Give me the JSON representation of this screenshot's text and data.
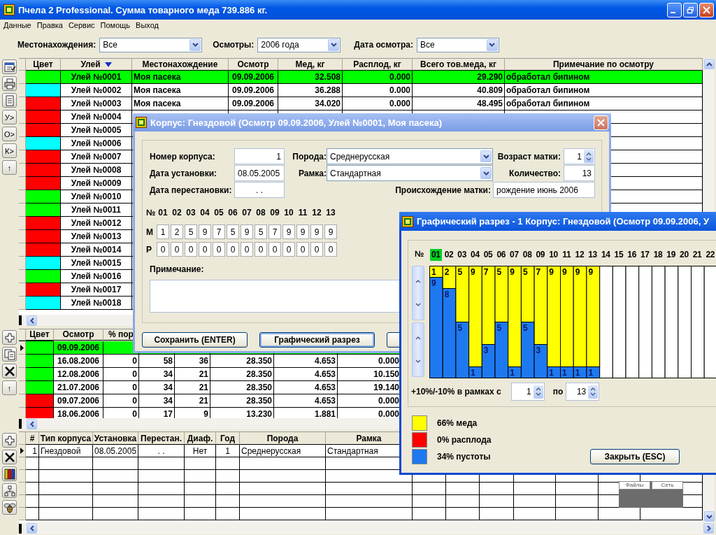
{
  "window": {
    "title": "Пчела 2 Professional. Сумма товарного меда 739.886 кг."
  },
  "menu": [
    "Данные",
    "Правка",
    "Сервис",
    "Помощь",
    "Выход"
  ],
  "filters": [
    {
      "label": "Местонахождения:",
      "value": "Все"
    },
    {
      "label": "Осмотры:",
      "value": "2006 года"
    },
    {
      "label": "Дата осмотра:",
      "value": "Все"
    }
  ],
  "hives_toolbar": [
    {
      "kind": "properties"
    },
    {
      "kind": "print"
    },
    {
      "kind": "document"
    },
    {
      "kind": "text",
      "label": "У>"
    },
    {
      "kind": "text",
      "label": "О>"
    },
    {
      "kind": "text",
      "label": "К>"
    },
    {
      "kind": "text",
      "label": "↑"
    }
  ],
  "hives_table": {
    "columns": [
      {
        "label": "Цвет",
        "sorted": false
      },
      {
        "label": "Улей",
        "sorted": true
      },
      {
        "label": "Местонахождение",
        "sorted": false
      },
      {
        "label": "Осмотр",
        "sorted": false
      },
      {
        "label": "Мед, кг",
        "sorted": false
      },
      {
        "label": "Расплод, кг",
        "sorted": false
      },
      {
        "label": "Всего тов.меда, кг",
        "sorted": false
      },
      {
        "label": "Примечание по осмотру",
        "sorted": false
      }
    ],
    "rows": [
      {
        "selected": true,
        "color": "#00ff00",
        "cells": [
          "",
          "Улей №0001",
          "Моя пасека",
          "09.09.2006",
          "32.508",
          "0.000",
          "29.290",
          "обработал бипином"
        ]
      },
      {
        "selected": false,
        "color": "#00ffff",
        "cells": [
          "",
          "Улей №0002",
          "Моя пасека",
          "09.09.2006",
          "36.288",
          "0.000",
          "40.809",
          "обработал бипином"
        ]
      },
      {
        "selected": false,
        "color": "#ff0000",
        "cells": [
          "",
          "Улей №0003",
          "Моя пасека",
          "09.09.2006",
          "34.020",
          "0.000",
          "48.495",
          "обработал бипином"
        ]
      },
      {
        "selected": false,
        "color": "#ff0000",
        "cells": [
          "",
          "Улей №0004"
        ]
      },
      {
        "selected": false,
        "color": "#ff0000",
        "cells": [
          "",
          "Улей №0005"
        ]
      },
      {
        "selected": false,
        "color": "#00ffff",
        "cells": [
          "",
          "Улей №0006"
        ]
      },
      {
        "selected": false,
        "color": "#ff0000",
        "cells": [
          "",
          "Улей №0007"
        ]
      },
      {
        "selected": false,
        "color": "#ff0000",
        "cells": [
          "",
          "Улей №0008"
        ]
      },
      {
        "selected": false,
        "color": "#ff0000",
        "cells": [
          "",
          "Улей №0009"
        ]
      },
      {
        "selected": false,
        "color": "#00ff00",
        "cells": [
          "",
          "Улей №0010"
        ]
      },
      {
        "selected": false,
        "color": "#00ff00",
        "cells": [
          "",
          "Улей №0011"
        ]
      },
      {
        "selected": false,
        "color": "#ff0000",
        "cells": [
          "",
          "Улей №0012"
        ]
      },
      {
        "selected": false,
        "color": "#ff0000",
        "cells": [
          "",
          "Улей №0013"
        ]
      },
      {
        "selected": false,
        "color": "#ff0000",
        "cells": [
          "",
          "Улей №0014"
        ]
      },
      {
        "selected": false,
        "color": "#00ffff",
        "cells": [
          "",
          "Улей №0015"
        ]
      },
      {
        "selected": false,
        "color": "#00ff00",
        "cells": [
          "",
          "Улей №0016"
        ]
      },
      {
        "selected": false,
        "color": "#ff0000",
        "cells": [
          "",
          "Улей №0017"
        ]
      },
      {
        "selected": false,
        "color": "#00ffff",
        "cells": [
          "",
          "Улей №0018"
        ]
      }
    ]
  },
  "inspections_toolbar": [
    {
      "kind": "add"
    },
    {
      "kind": "copy"
    },
    {
      "kind": "delete"
    },
    {
      "kind": "text",
      "label": "↑"
    }
  ],
  "inspections_table": {
    "columns": [
      "Цвет",
      "Осмотр",
      "% пор"
    ],
    "rows": [
      {
        "selected": true,
        "color": "#00ff00",
        "cells": [
          "",
          "09.09.2006"
        ]
      },
      {
        "selected": false,
        "color": "#00ff00",
        "cells": [
          "",
          "16.08.2006",
          "0",
          "58",
          "36",
          "28.350",
          "4.653",
          "0.000"
        ]
      },
      {
        "selected": false,
        "color": "#00ff00",
        "cells": [
          "",
          "12.08.2006",
          "0",
          "34",
          "21",
          "28.350",
          "4.653",
          "10.150"
        ]
      },
      {
        "selected": false,
        "color": "#00ff00",
        "cells": [
          "",
          "21.07.2006",
          "0",
          "34",
          "21",
          "28.350",
          "4.653",
          "19.140"
        ]
      },
      {
        "selected": false,
        "color": "#ff0000",
        "cells": [
          "",
          "09.07.2006",
          "0",
          "34",
          "21",
          "28.350",
          "4.653",
          "0.000"
        ]
      },
      {
        "selected": false,
        "color": "#ff0000",
        "cells": [
          "",
          "18.06.2006",
          "0",
          "17",
          "9",
          "13.230",
          "1.881",
          "0.000"
        ]
      }
    ]
  },
  "cases_toolbar": [
    {
      "kind": "add"
    },
    {
      "kind": "delete"
    },
    {
      "kind": "chart"
    },
    {
      "kind": "tree"
    },
    {
      "kind": "bee"
    }
  ],
  "cases_table": {
    "columns": [
      "#",
      "Тип корпуса",
      "Установка",
      "Перестан.",
      "Диаф.",
      "Год",
      "Порода",
      "Рамка"
    ],
    "rows": [
      {
        "selected": true,
        "cells": [
          "1",
          "Гнездовой",
          "08.05.2005",
          ". .",
          "Нет",
          "1",
          "Среднерусская",
          "Стандартная"
        ]
      }
    ]
  },
  "mini_panel": {
    "tabs": [
      "Файлы",
      "Сеть"
    ]
  },
  "case_dialog": {
    "title": "Корпус: Гнездовой (Осмотр 09.09.2006, Улей №0001, Моя пасека)",
    "number": {
      "label": "Номер корпуса:",
      "value": "1"
    },
    "installed": {
      "label": "Дата установки:",
      "value": "08.05.2005"
    },
    "moved": {
      "label": "Дата перестановки:",
      "value": ". ."
    },
    "breed": {
      "label": "Порода:",
      "value": "Среднерусская"
    },
    "frame": {
      "label": "Рамка:",
      "value": "Стандартная"
    },
    "queen_age": {
      "label": "Возраст матки:",
      "value": "1"
    },
    "count": {
      "label": "Количество:",
      "value": "13"
    },
    "queen_origin": {
      "label": "Происхождение матки:",
      "value": "рождение июнь 2006"
    },
    "frames_header": "№",
    "frame_numbers": [
      "01",
      "02",
      "03",
      "04",
      "05",
      "06",
      "07",
      "08",
      "09",
      "10",
      "11",
      "12",
      "13"
    ],
    "frame_rows": [
      {
        "label": "М",
        "values": [
          "1",
          "2",
          "5",
          "9",
          "7",
          "5",
          "9",
          "5",
          "7",
          "9",
          "9",
          "9",
          "9"
        ]
      },
      {
        "label": "Р",
        "values": [
          "0",
          "0",
          "0",
          "0",
          "0",
          "0",
          "0",
          "0",
          "0",
          "0",
          "0",
          "0",
          "0"
        ]
      }
    ],
    "note_label": "Примечание:",
    "buttons": [
      "Сохранить (ENTER)",
      "Графический разрез"
    ]
  },
  "section_dialog": {
    "title": "Графический разрез - 1 Корпус: Гнездовой (Осмотр 09.09.2006, У",
    "number_label": "№",
    "category_selected": [
      true,
      false,
      false,
      false,
      false,
      false,
      false,
      false,
      false,
      false,
      false,
      false,
      false,
      false,
      false,
      false,
      false,
      false,
      false,
      false,
      false,
      false
    ],
    "chart_data": {
      "type": "bar",
      "stacked": true,
      "data_labels": true,
      "ylim": [
        0,
        10
      ],
      "categories": [
        "01",
        "02",
        "03",
        "04",
        "05",
        "06",
        "07",
        "08",
        "09",
        "10",
        "11",
        "12",
        "13",
        "14",
        "15",
        "16",
        "17",
        "18",
        "19",
        "20",
        "21",
        "22"
      ],
      "series": [
        {
          "color": "#1e78f0",
          "values": [
            9,
            8,
            5,
            1,
            3,
            5,
            1,
            5,
            3,
            1,
            1,
            1,
            1,
            null,
            null,
            null,
            null,
            null,
            null,
            null,
            null,
            null
          ]
        },
        {
          "color": "#ffff00",
          "values": [
            1,
            2,
            5,
            9,
            7,
            5,
            9,
            5,
            7,
            9,
            9,
            9,
            9,
            null,
            null,
            null,
            null,
            null,
            null,
            null,
            null,
            null
          ]
        }
      ]
    },
    "range": {
      "label": "+10%/-10% в рамках с",
      "from": "1",
      "to_label": "по",
      "to": "13"
    },
    "legend": [
      {
        "color": "#ffff00",
        "label": "66% меда"
      },
      {
        "color": "#ff0000",
        "label": "0% расплода"
      },
      {
        "color": "#1e78f0",
        "label": "34% пустоты"
      }
    ],
    "close_button": "Закрыть (ESC)"
  }
}
